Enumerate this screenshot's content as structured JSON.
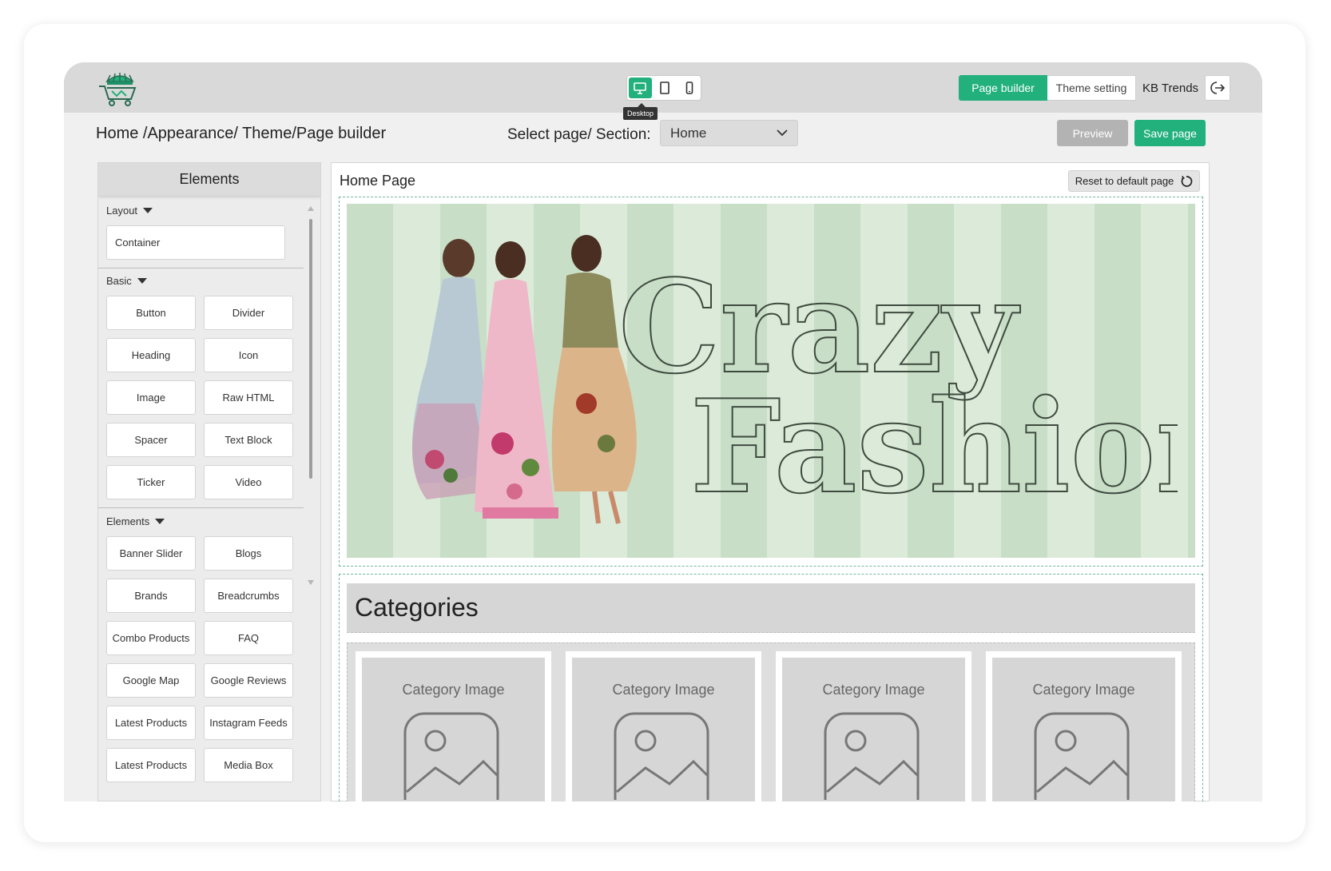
{
  "topbar": {
    "device_tooltip": "Desktop",
    "devices": [
      "desktop-icon",
      "tablet-icon",
      "mobile-icon"
    ],
    "tabs": {
      "page_builder": "Page builder",
      "theme_setting": "Theme setting"
    },
    "store_name": "KB Trends",
    "accent_color": "#22b07d"
  },
  "subheader": {
    "breadcrumb": "Home /Appearance/ Theme/Page builder",
    "select_label": "Select page/ Section:",
    "selected_page": "Home",
    "preview_label": "Preview",
    "save_label": "Save page"
  },
  "sidebar": {
    "title": "Elements",
    "sections": [
      {
        "label": "Layout",
        "items": [
          "Container"
        ]
      },
      {
        "label": "Basic",
        "items": [
          "Button",
          "Divider",
          "Heading",
          "Icon",
          "Image",
          "Raw HTML",
          "Spacer",
          "Text Block",
          "Ticker",
          "Video"
        ]
      },
      {
        "label": "Elements",
        "items": [
          "Banner Slider",
          "Blogs",
          "Brands",
          "Breadcrumbs",
          "Combo Products",
          "FAQ",
          "Google Map",
          "Google Reviews",
          "Latest Products",
          "Instagram Feeds",
          "Latest Products",
          "Media Box"
        ]
      }
    ]
  },
  "canvas": {
    "title": "Home Page",
    "reset_label": "Reset to default page",
    "banner": {
      "line1": "Crazy",
      "line2": "Fashion"
    },
    "categories_title": "Categories",
    "category_placeholder": "Category Image"
  }
}
